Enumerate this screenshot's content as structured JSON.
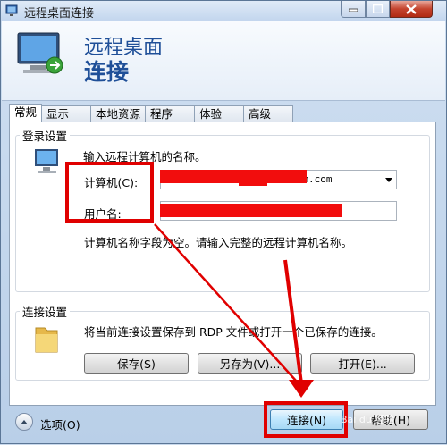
{
  "window": {
    "title": "远程桌面连接",
    "controls": {
      "minimize": "minimize-icon",
      "maximize": "maximize-icon",
      "close": "close-icon"
    }
  },
  "header": {
    "line1": "远程桌面",
    "line2": "连接"
  },
  "tabs": [
    {
      "label": "常规",
      "active": true
    },
    {
      "label": "显示"
    },
    {
      "label": "本地资源"
    },
    {
      "label": "程序"
    },
    {
      "label": "体验"
    },
    {
      "label": "高级"
    }
  ],
  "login": {
    "group_label": "登录设置",
    "prompt": "输入远程计算机的名称。",
    "computer_label": "计算机(C):",
    "computer_value": "fabrikam.com",
    "username_label": "用户名:",
    "username_value": "",
    "hint": "计算机名称字段为空。请输入完整的远程计算机名称。"
  },
  "connection": {
    "group_label": "连接设置",
    "description": "将当前连接设置保存到 RDP 文件或打开一个已保存的连接。",
    "save_label": "保存(S)",
    "save_as_label": "另存为(V)...",
    "open_label": "打开(E)..."
  },
  "footer": {
    "options_label": "选项(O)",
    "connect_label": "连接(N)",
    "help_label": "帮助(H)"
  },
  "annotations": {
    "highlight_color": "#e00000",
    "redaction_color": "#f20d0d"
  },
  "watermark": "Bai du 经验"
}
